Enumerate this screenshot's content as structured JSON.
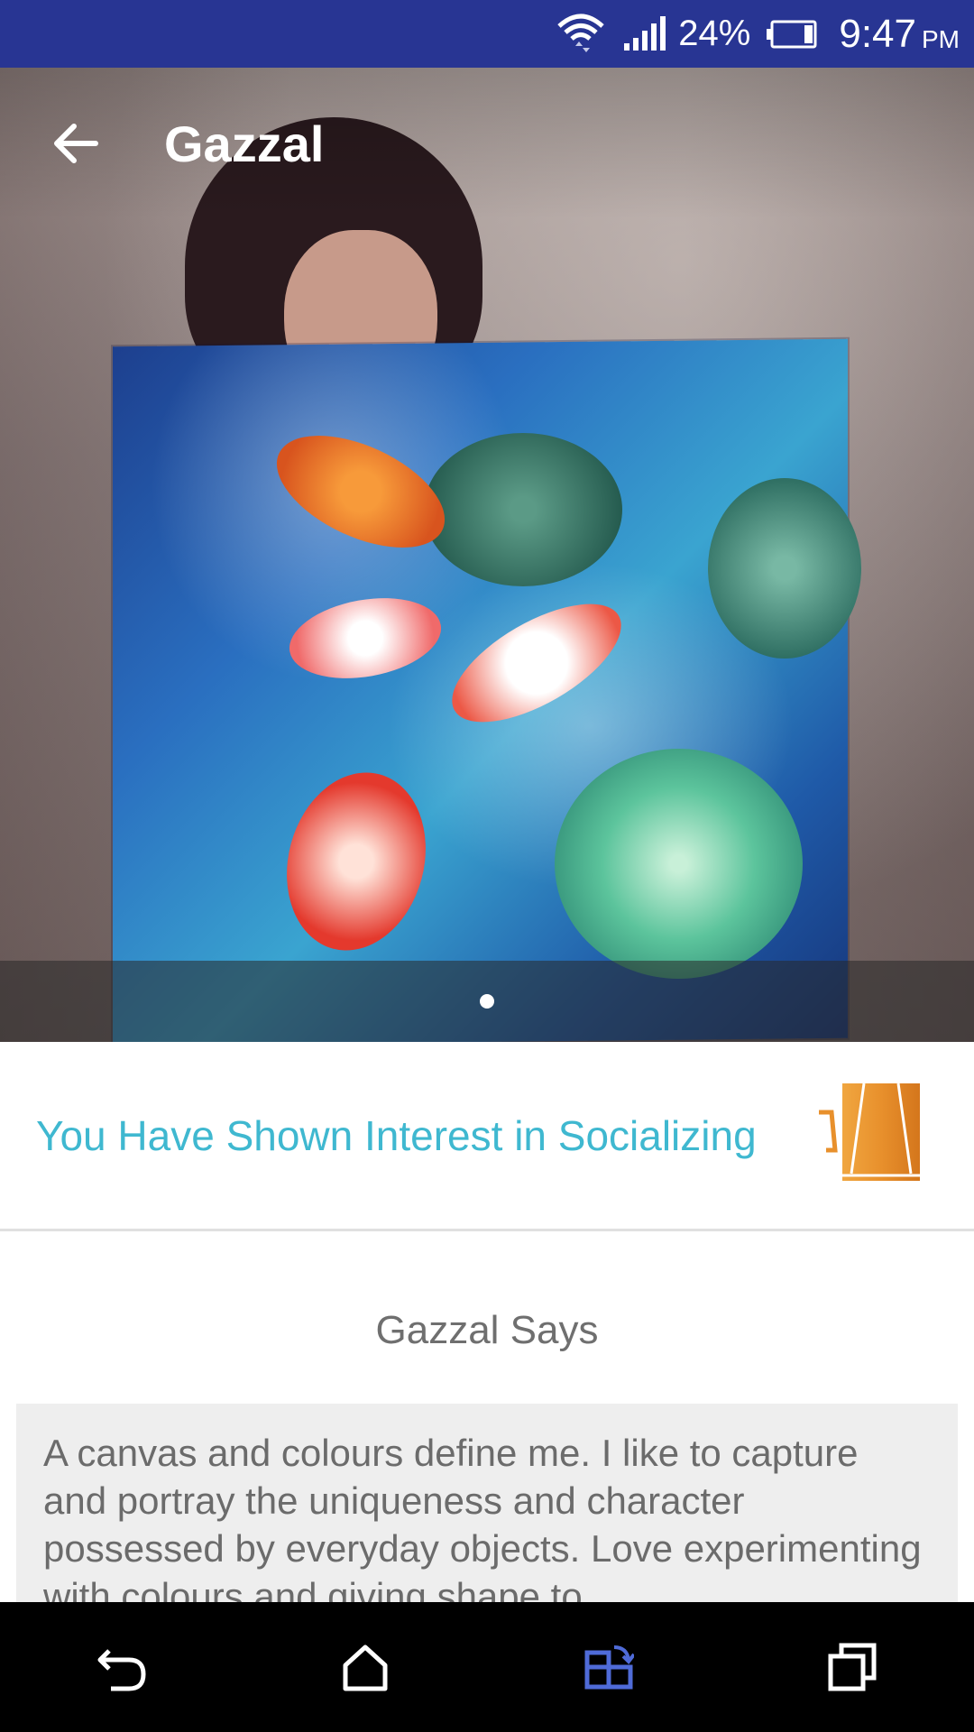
{
  "status_bar": {
    "battery_percent": "24%",
    "time": "9:47",
    "ampm": "PM"
  },
  "app_bar": {
    "title": "Gazzal"
  },
  "gallery": {
    "page_count": 1,
    "current_page": 1
  },
  "interest": {
    "text": "You Have Shown Interest in Socializing",
    "icon": "socializing-drink-icon",
    "icon_color": "#e8902c"
  },
  "says": {
    "title": "Gazzal Says",
    "text": "A canvas and colours define me. I like to capture and portray the uniqueness and character possessed by everyday objects. Love experimenting with colours and giving shape to"
  },
  "nav_bar": {
    "items": [
      "back-icon",
      "home-icon",
      "screen-rotate-icon",
      "recents-icon"
    ],
    "active_color": "#4f6bd8"
  },
  "colors": {
    "status_bar": "#283593",
    "accent_text": "#3fb8d0"
  }
}
